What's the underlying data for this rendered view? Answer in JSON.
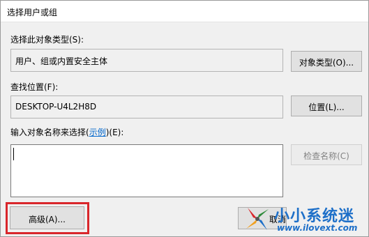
{
  "window": {
    "title": "选择用户或组"
  },
  "object_types": {
    "label": "选择此对象类型(S):",
    "value": "用户、组或内置安全主体",
    "button_label": "对象类型(O)..."
  },
  "location": {
    "label": "查找位置(F):",
    "value": "DESKTOP-U4L2H8D",
    "button_label": "位置(L)..."
  },
  "names": {
    "label_prefix": "输入对象名称来选择(",
    "label_link": "示例",
    "label_suffix": ")(E):",
    "value": "",
    "check_names_label": "检查名称(C)"
  },
  "footer": {
    "advanced_label": "高级(A)...",
    "partial_button_label": "取消"
  },
  "watermark": {
    "logo": "windmill-logo-icon",
    "text": "小小系统迷",
    "url": "www.ilovext.com"
  },
  "colors": {
    "highlight": "#d9262b",
    "link": "#0066cc",
    "watermark": "#1d6fc8"
  }
}
